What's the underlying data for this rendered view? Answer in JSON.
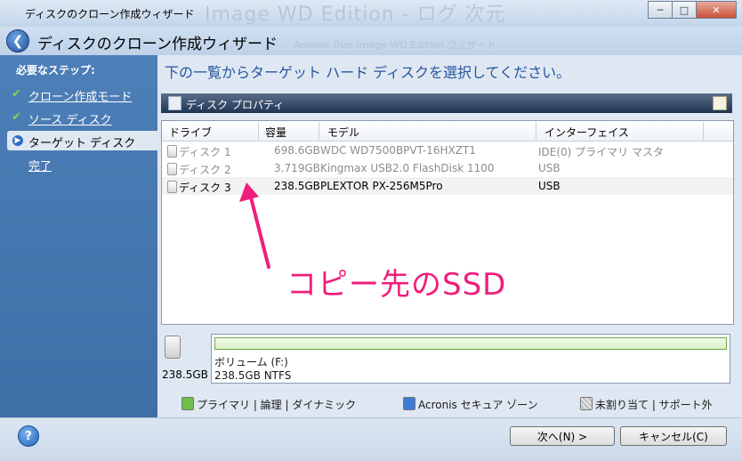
{
  "window": {
    "title": "ディスクのクローン作成ウィザード",
    "background_ghost": "Image WD Edition - ログ 次元",
    "controls": {
      "minimize": "─",
      "maximize": "□",
      "close": "✕"
    }
  },
  "header": {
    "back_icon": "back-arrow-icon",
    "title": "ディスクのクローン作成ウィザード",
    "ghost_text": "Acronis True Image WD Edition  ウィザード"
  },
  "sidebar": {
    "heading": "必要なステップ:",
    "steps": [
      {
        "label": "クローン作成モード",
        "state": "done"
      },
      {
        "label": "ソース ディスク",
        "state": "done"
      },
      {
        "label": "ターゲット ディスク",
        "state": "current"
      },
      {
        "label": "完了",
        "state": "pending"
      }
    ]
  },
  "main": {
    "instruction": "下の一覧からターゲット ハード ディスクを選択してください。",
    "properties_bar": "ディスク プロパティ",
    "table": {
      "columns": [
        "ドライブ",
        "容量",
        "モデル",
        "インターフェイス"
      ],
      "rows": [
        {
          "drive": "ディスク 1",
          "capacity": "698.6GB",
          "model": "WDC WD7500BPVT-16HXZT1",
          "interface": "IDE(0) プライマリ マスタ",
          "state": "disabled"
        },
        {
          "drive": "ディスク 2",
          "capacity": "3.719GB",
          "model": "Kingmax USB2.0 FlashDisk 1100",
          "interface": "USB",
          "state": "disabled"
        },
        {
          "drive": "ディスク 3",
          "capacity": "238.5GB",
          "model": "PLEXTOR PX-256M5Pro",
          "interface": "USB",
          "state": "selected"
        }
      ]
    },
    "volume": {
      "disk_size": "238.5GB",
      "name": "ボリューム (F:)",
      "info": "238.5GB  NTFS"
    },
    "legend": [
      {
        "label": "プライマリ | 論理 | ダイナミック",
        "color": "#6cc04a"
      },
      {
        "label": "Acronis セキュア ゾーン",
        "color": "#3d7bd6"
      },
      {
        "label": "未割り当て | サポート外",
        "color": "#d0d0d0"
      }
    ]
  },
  "footer": {
    "help": "?",
    "next_button": "次へ(N) >",
    "cancel_button": "キャンセル(C)"
  },
  "annotation": {
    "text": "コピー先のSSD",
    "color": "#ef1e7b"
  }
}
